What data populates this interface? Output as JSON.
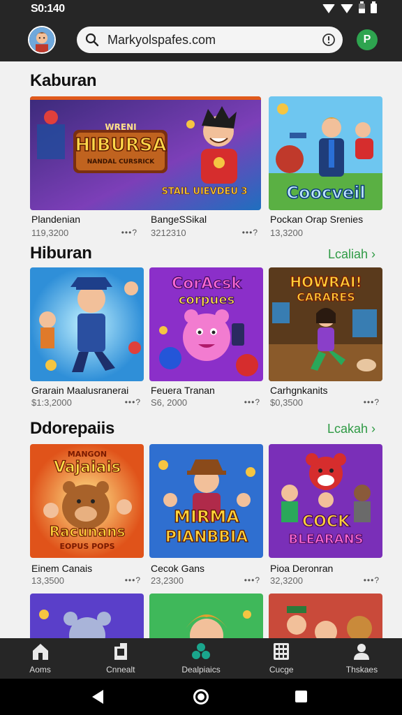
{
  "status_bar": {
    "time": "S0:140"
  },
  "header": {
    "search_text": "Markyolspafes.com",
    "profile_initial": "P"
  },
  "sections": [
    {
      "title": "Kaburan",
      "link": "",
      "cards": [
        {
          "title": "Plandenian",
          "meta": "119,3200",
          "dots": "•••?",
          "art_text": [
            "HIBURSA",
            "WRENI",
            "NANDAL CURSRICK",
            "STAIL UIEVDEU 3"
          ]
        },
        {
          "title": "BangeSSikal",
          "meta": "3212310",
          "dots": "•••?",
          "art_text": []
        },
        {
          "title": "Pockan Orap Srenies",
          "meta": "13,3200",
          "dots": "•••?",
          "art_text": [
            "Coocveil"
          ]
        }
      ]
    },
    {
      "title": "Hiburan",
      "link": "Lcaliah ›",
      "cards": [
        {
          "title": "Grarain Maalusranerai",
          "meta": "$1:3,2000",
          "dots": "•••?",
          "art_text": []
        },
        {
          "title": "Feuera Tranan",
          "meta": "S6, 2000",
          "dots": "•••?",
          "art_text": [
            "CorAcsk",
            "corpues"
          ]
        },
        {
          "title": "Carhgnkanits",
          "meta": "$0,3500",
          "dots": "•••?",
          "art_text": [
            "HOWRAI!",
            "CARARES"
          ]
        }
      ]
    },
    {
      "title": "Ddorepaiis",
      "link": "Lcakah ›",
      "cards": [
        {
          "title": "Einem Canais",
          "meta": "13,3500",
          "dots": "•••?",
          "art_text": [
            "MANGON",
            "Vajaiais",
            "Racunans",
            "EOPUS POPS"
          ]
        },
        {
          "title": "Cecok Gans",
          "meta": "23,2300",
          "dots": "•••?",
          "art_text": [
            "MIRMA",
            "PIANBBIA"
          ]
        },
        {
          "title": "Pioa Deronran",
          "meta": "32,3200",
          "dots": "•••?",
          "art_text": [
            "COCK",
            "BLEARANS"
          ]
        }
      ]
    }
  ],
  "bottom_nav": [
    {
      "label": "Aoms",
      "icon": "home-icon"
    },
    {
      "label": "Cnnealt",
      "icon": "document-icon"
    },
    {
      "label": "Dealpiaics",
      "icon": "apps-cluster-icon",
      "active_color": "#1aa58c"
    },
    {
      "label": "Cucge",
      "icon": "grid-icon"
    },
    {
      "label": "Thskaes",
      "icon": "person-icon"
    }
  ]
}
